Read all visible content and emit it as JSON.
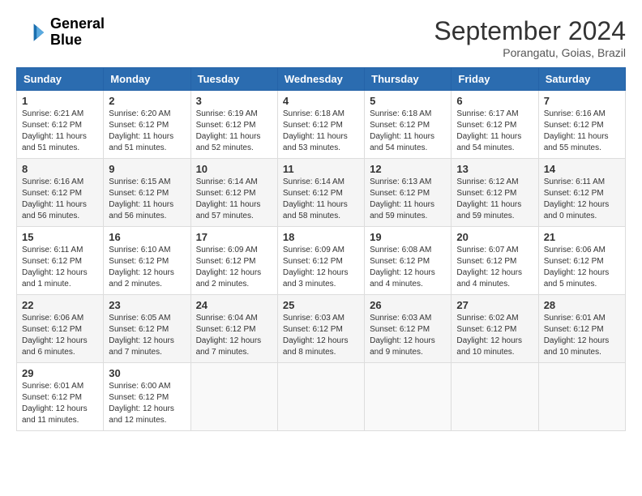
{
  "header": {
    "logo_line1": "General",
    "logo_line2": "Blue",
    "month_year": "September 2024",
    "location": "Porangatu, Goias, Brazil"
  },
  "weekdays": [
    "Sunday",
    "Monday",
    "Tuesday",
    "Wednesday",
    "Thursday",
    "Friday",
    "Saturday"
  ],
  "weeks": [
    [
      {
        "day": "1",
        "sunrise": "Sunrise: 6:21 AM",
        "sunset": "Sunset: 6:12 PM",
        "daylight": "Daylight: 11 hours and 51 minutes."
      },
      {
        "day": "2",
        "sunrise": "Sunrise: 6:20 AM",
        "sunset": "Sunset: 6:12 PM",
        "daylight": "Daylight: 11 hours and 51 minutes."
      },
      {
        "day": "3",
        "sunrise": "Sunrise: 6:19 AM",
        "sunset": "Sunset: 6:12 PM",
        "daylight": "Daylight: 11 hours and 52 minutes."
      },
      {
        "day": "4",
        "sunrise": "Sunrise: 6:18 AM",
        "sunset": "Sunset: 6:12 PM",
        "daylight": "Daylight: 11 hours and 53 minutes."
      },
      {
        "day": "5",
        "sunrise": "Sunrise: 6:18 AM",
        "sunset": "Sunset: 6:12 PM",
        "daylight": "Daylight: 11 hours and 54 minutes."
      },
      {
        "day": "6",
        "sunrise": "Sunrise: 6:17 AM",
        "sunset": "Sunset: 6:12 PM",
        "daylight": "Daylight: 11 hours and 54 minutes."
      },
      {
        "day": "7",
        "sunrise": "Sunrise: 6:16 AM",
        "sunset": "Sunset: 6:12 PM",
        "daylight": "Daylight: 11 hours and 55 minutes."
      }
    ],
    [
      {
        "day": "8",
        "sunrise": "Sunrise: 6:16 AM",
        "sunset": "Sunset: 6:12 PM",
        "daylight": "Daylight: 11 hours and 56 minutes."
      },
      {
        "day": "9",
        "sunrise": "Sunrise: 6:15 AM",
        "sunset": "Sunset: 6:12 PM",
        "daylight": "Daylight: 11 hours and 56 minutes."
      },
      {
        "day": "10",
        "sunrise": "Sunrise: 6:14 AM",
        "sunset": "Sunset: 6:12 PM",
        "daylight": "Daylight: 11 hours and 57 minutes."
      },
      {
        "day": "11",
        "sunrise": "Sunrise: 6:14 AM",
        "sunset": "Sunset: 6:12 PM",
        "daylight": "Daylight: 11 hours and 58 minutes."
      },
      {
        "day": "12",
        "sunrise": "Sunrise: 6:13 AM",
        "sunset": "Sunset: 6:12 PM",
        "daylight": "Daylight: 11 hours and 59 minutes."
      },
      {
        "day": "13",
        "sunrise": "Sunrise: 6:12 AM",
        "sunset": "Sunset: 6:12 PM",
        "daylight": "Daylight: 11 hours and 59 minutes."
      },
      {
        "day": "14",
        "sunrise": "Sunrise: 6:11 AM",
        "sunset": "Sunset: 6:12 PM",
        "daylight": "Daylight: 12 hours and 0 minutes."
      }
    ],
    [
      {
        "day": "15",
        "sunrise": "Sunrise: 6:11 AM",
        "sunset": "Sunset: 6:12 PM",
        "daylight": "Daylight: 12 hours and 1 minute."
      },
      {
        "day": "16",
        "sunrise": "Sunrise: 6:10 AM",
        "sunset": "Sunset: 6:12 PM",
        "daylight": "Daylight: 12 hours and 2 minutes."
      },
      {
        "day": "17",
        "sunrise": "Sunrise: 6:09 AM",
        "sunset": "Sunset: 6:12 PM",
        "daylight": "Daylight: 12 hours and 2 minutes."
      },
      {
        "day": "18",
        "sunrise": "Sunrise: 6:09 AM",
        "sunset": "Sunset: 6:12 PM",
        "daylight": "Daylight: 12 hours and 3 minutes."
      },
      {
        "day": "19",
        "sunrise": "Sunrise: 6:08 AM",
        "sunset": "Sunset: 6:12 PM",
        "daylight": "Daylight: 12 hours and 4 minutes."
      },
      {
        "day": "20",
        "sunrise": "Sunrise: 6:07 AM",
        "sunset": "Sunset: 6:12 PM",
        "daylight": "Daylight: 12 hours and 4 minutes."
      },
      {
        "day": "21",
        "sunrise": "Sunrise: 6:06 AM",
        "sunset": "Sunset: 6:12 PM",
        "daylight": "Daylight: 12 hours and 5 minutes."
      }
    ],
    [
      {
        "day": "22",
        "sunrise": "Sunrise: 6:06 AM",
        "sunset": "Sunset: 6:12 PM",
        "daylight": "Daylight: 12 hours and 6 minutes."
      },
      {
        "day": "23",
        "sunrise": "Sunrise: 6:05 AM",
        "sunset": "Sunset: 6:12 PM",
        "daylight": "Daylight: 12 hours and 7 minutes."
      },
      {
        "day": "24",
        "sunrise": "Sunrise: 6:04 AM",
        "sunset": "Sunset: 6:12 PM",
        "daylight": "Daylight: 12 hours and 7 minutes."
      },
      {
        "day": "25",
        "sunrise": "Sunrise: 6:03 AM",
        "sunset": "Sunset: 6:12 PM",
        "daylight": "Daylight: 12 hours and 8 minutes."
      },
      {
        "day": "26",
        "sunrise": "Sunrise: 6:03 AM",
        "sunset": "Sunset: 6:12 PM",
        "daylight": "Daylight: 12 hours and 9 minutes."
      },
      {
        "day": "27",
        "sunrise": "Sunrise: 6:02 AM",
        "sunset": "Sunset: 6:12 PM",
        "daylight": "Daylight: 12 hours and 10 minutes."
      },
      {
        "day": "28",
        "sunrise": "Sunrise: 6:01 AM",
        "sunset": "Sunset: 6:12 PM",
        "daylight": "Daylight: 12 hours and 10 minutes."
      }
    ],
    [
      {
        "day": "29",
        "sunrise": "Sunrise: 6:01 AM",
        "sunset": "Sunset: 6:12 PM",
        "daylight": "Daylight: 12 hours and 11 minutes."
      },
      {
        "day": "30",
        "sunrise": "Sunrise: 6:00 AM",
        "sunset": "Sunset: 6:12 PM",
        "daylight": "Daylight: 12 hours and 12 minutes."
      },
      null,
      null,
      null,
      null,
      null
    ]
  ]
}
